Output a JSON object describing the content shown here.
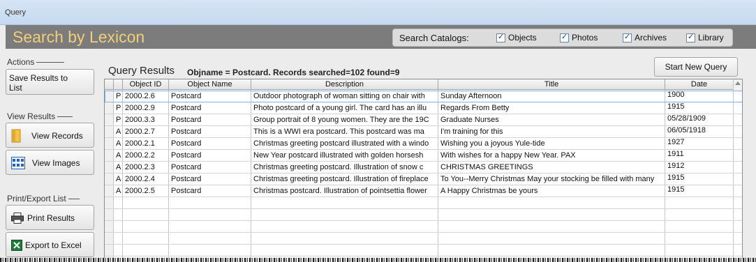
{
  "window": {
    "title": "Query"
  },
  "header": {
    "title": "Search by Lexicon"
  },
  "catalogs": {
    "label": "Search Catalogs:",
    "options": [
      {
        "label": "Objects",
        "checked": true
      },
      {
        "label": "Photos",
        "checked": true
      },
      {
        "label": "Archives",
        "checked": true
      },
      {
        "label": "Library",
        "checked": true
      }
    ]
  },
  "sidebar": {
    "actions": {
      "heading": "Actions",
      "save_label_1": "Save Results to",
      "save_label_2": "List"
    },
    "view": {
      "heading": "View Results",
      "records_label": "View Records",
      "images_label": "View Images"
    },
    "export": {
      "heading": "Print/Export List",
      "print_label": "Print Results",
      "excel_label": "Export to Excel"
    }
  },
  "results": {
    "label": "Query Results",
    "info": "Objname = Postcard.   Records searched=102 found=9",
    "new_query_label": "Start New Query",
    "columns": [
      "",
      "Object ID",
      "Object Name",
      "Description",
      "Title",
      "Date"
    ],
    "rows": [
      {
        "type": "P",
        "id": "2000.2.6",
        "name": "Postcard",
        "description": "Outdoor photograph of woman sitting on chair with",
        "title": "Sunday Afternoon",
        "date": "1900"
      },
      {
        "type": "P",
        "id": "2000.2.9",
        "name": "Postcard",
        "description": "Photo postcard of a young girl.  The card has an illu",
        "title": "Regards From Betty",
        "date": "1915"
      },
      {
        "type": "P",
        "id": "2000.3.3",
        "name": "Postcard",
        "description": "Group portrait of 8 young women. They are the 19C",
        "title": "Graduate Nurses",
        "date": "05/28/1909"
      },
      {
        "type": "A",
        "id": "2000.2.7",
        "name": "Postcard",
        "description": "This is a WWI era postcard.  This postcard was ma",
        "title": "I'm training for this",
        "date": "06/05/1918"
      },
      {
        "type": "A",
        "id": "2000.2.1",
        "name": "Postcard",
        "description": "Christmas greeting postcard illustrated with a windo",
        "title": "Wishing you a joyous Yule-tide",
        "date": "1927"
      },
      {
        "type": "A",
        "id": "2000.2.2",
        "name": "Postcard",
        "description": "New Year postcard illustrated with golden horsesh",
        "title": "With wishes for a happy New Year. PAX",
        "date": "1911"
      },
      {
        "type": "A",
        "id": "2000.2.3",
        "name": "Postcard",
        "description": "Christmas greeting postcard.  Illustration of snow c",
        "title": "CHRISTMAS GREETINGS",
        "date": "1912"
      },
      {
        "type": "A",
        "id": "2000.2.4",
        "name": "Postcard",
        "description": "Christmas greeting postcard.  Illustration of fireplace",
        "title": "To You--Merry Christmas May your stocking be filled with many",
        "date": "1915"
      },
      {
        "type": "A",
        "id": "2000.2.5",
        "name": "Postcard",
        "description": "Christmas postcard. Illustration of pointsettia flower",
        "title": "A Happy Christmas be yours",
        "date": "1915"
      }
    ]
  }
}
